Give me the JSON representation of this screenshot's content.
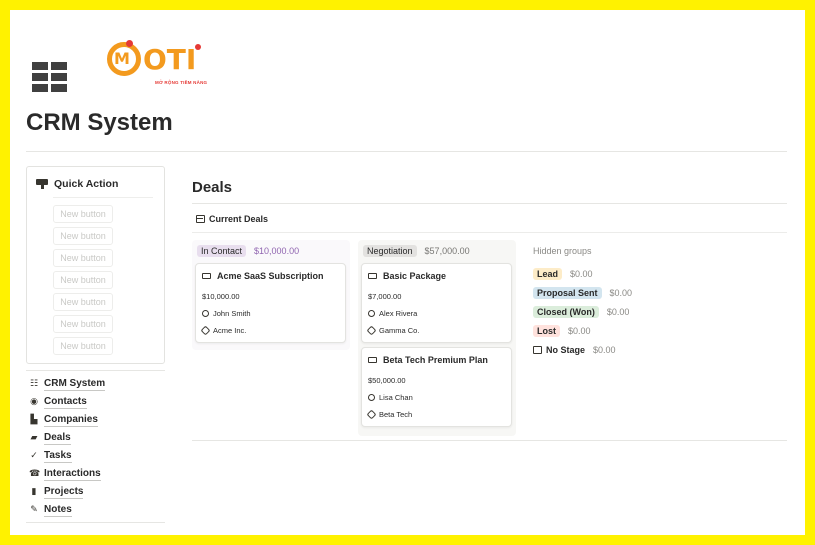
{
  "logo": {
    "letter_m": "M",
    "name": "OTI",
    "tagline": "MỞ RỘNG TIỀM NĂNG"
  },
  "page": {
    "title": "CRM System"
  },
  "quick_action": {
    "label": "Quick Action",
    "buttons": [
      "New button",
      "New button",
      "New button",
      "New button",
      "New button",
      "New button",
      "New button"
    ]
  },
  "nav": {
    "items": [
      {
        "label": "CRM System",
        "icon": "list-icon"
      },
      {
        "label": "Contacts",
        "icon": "user-circle-icon"
      },
      {
        "label": "Companies",
        "icon": "buildings-icon"
      },
      {
        "label": "Deals",
        "icon": "deals-icon"
      },
      {
        "label": "Tasks",
        "icon": "check-icon"
      },
      {
        "label": "Interactions",
        "icon": "phone-icon"
      },
      {
        "label": "Projects",
        "icon": "document-icon"
      },
      {
        "label": "Notes",
        "icon": "notes-icon"
      }
    ]
  },
  "deals": {
    "title": "Deals",
    "view_label": "Current Deals",
    "columns": [
      {
        "stage": "In Contact",
        "sum": "$10,000.00",
        "color": "#e8deee",
        "cards": [
          {
            "title": "Acme SaaS Subscription",
            "value": "$10,000.00",
            "contact": "John Smith",
            "company": "Acme Inc."
          }
        ]
      },
      {
        "stage": "Negotiation",
        "sum": "$57,000.00",
        "color": "#e3e2e0",
        "cards": [
          {
            "title": "Basic Package",
            "value": "$7,000.00",
            "contact": "Alex Rivera",
            "company": "Gamma Co."
          },
          {
            "title": "Beta Tech Premium Plan",
            "value": "$50,000.00",
            "contact": "Lisa Chan",
            "company": "Beta Tech"
          }
        ]
      }
    ],
    "hidden_groups": {
      "title": "Hidden groups",
      "groups": [
        {
          "label": "Lead",
          "amount": "$0.00",
          "color": "#fdecc8"
        },
        {
          "label": "Proposal Sent",
          "amount": "$0.00",
          "color": "#d3e5ef"
        },
        {
          "label": "Closed (Won)",
          "amount": "$0.00",
          "color": "#dbeddb"
        },
        {
          "label": "Lost",
          "amount": "$0.00",
          "color": "#ffe2dd"
        },
        {
          "label": "No Stage",
          "amount": "$0.00",
          "color": ""
        }
      ]
    }
  }
}
